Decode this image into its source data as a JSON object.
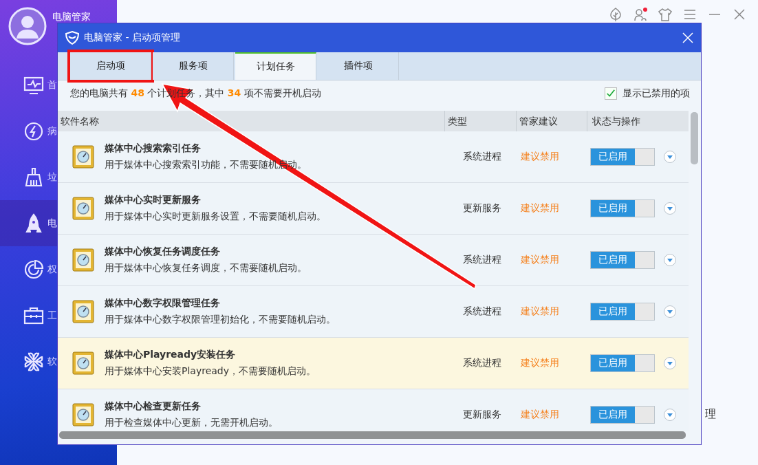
{
  "app": {
    "user_name": "电脑管家",
    "nav": [
      {
        "kind": "monitor",
        "label": "首",
        "selected": false
      },
      {
        "kind": "bolt",
        "label": "病",
        "selected": false
      },
      {
        "kind": "broom",
        "label": "垃",
        "selected": false
      },
      {
        "kind": "rocket",
        "label": "电",
        "selected": true
      },
      {
        "kind": "pie",
        "label": "权",
        "selected": false
      },
      {
        "kind": "toolbox",
        "label": "工",
        "selected": false
      },
      {
        "kind": "clover",
        "label": "软",
        "selected": false
      }
    ],
    "toolbar": [
      {
        "kind": "tree"
      },
      {
        "kind": "user",
        "badge": true
      },
      {
        "kind": "shirt"
      },
      {
        "kind": "menu"
      },
      {
        "kind": "minimize"
      },
      {
        "kind": "close"
      }
    ],
    "background_fragment": "理"
  },
  "dialog": {
    "title": "电脑管家 - 启动项管理",
    "tabs": [
      {
        "label": "启动项",
        "selected": false
      },
      {
        "label": "服务项",
        "selected": false
      },
      {
        "label": "计划任务",
        "selected": true
      },
      {
        "label": "插件项",
        "selected": false
      }
    ],
    "summary": {
      "prefix": "您的电脑共有",
      "total": "48",
      "middle": "个计划任务，其中",
      "count": "34",
      "suffix": "项不需要开机启动"
    },
    "show_disabled": {
      "label": "显示已禁用的项",
      "checked": true
    },
    "columns": [
      "软件名称",
      "类型",
      "管家建议",
      "状态与操作"
    ],
    "rows": [
      {
        "name": "媒体中心搜索索引任务",
        "desc": "用于媒体中心搜索索引功能，不需要随机启动。",
        "type": "系统进程",
        "advice": "建议禁用",
        "status": "已启用",
        "enabled": true,
        "selected": false
      },
      {
        "name": "媒体中心实时更新服务",
        "desc": "用于媒体中心实时更新服务设置，不需要随机启动。",
        "type": "更新服务",
        "advice": "建议禁用",
        "status": "已启用",
        "enabled": true,
        "selected": false
      },
      {
        "name": "媒体中心恢复任务调度任务",
        "desc": "用于媒体中心恢复任务调度，不需要随机启动。",
        "type": "系统进程",
        "advice": "建议禁用",
        "status": "已启用",
        "enabled": true,
        "selected": false
      },
      {
        "name": "媒体中心数字权限管理任务",
        "desc": "用于媒体中心数字权限管理初始化，不需要随机启动。",
        "type": "系统进程",
        "advice": "建议禁用",
        "status": "已启用",
        "enabled": true,
        "selected": false
      },
      {
        "name": "媒体中心Playready安装任务",
        "desc": "用于媒体中心安装Playready，不需要随机启动。",
        "type": "系统进程",
        "advice": "建议禁用",
        "status": "已启用",
        "enabled": true,
        "selected": true
      },
      {
        "name": "媒体中心检查更新任务",
        "desc": "用于检查媒体中心更新，无需开机启动。",
        "type": "更新服务",
        "advice": "建议禁用",
        "status": "已启用",
        "enabled": true,
        "selected": false
      }
    ]
  }
}
